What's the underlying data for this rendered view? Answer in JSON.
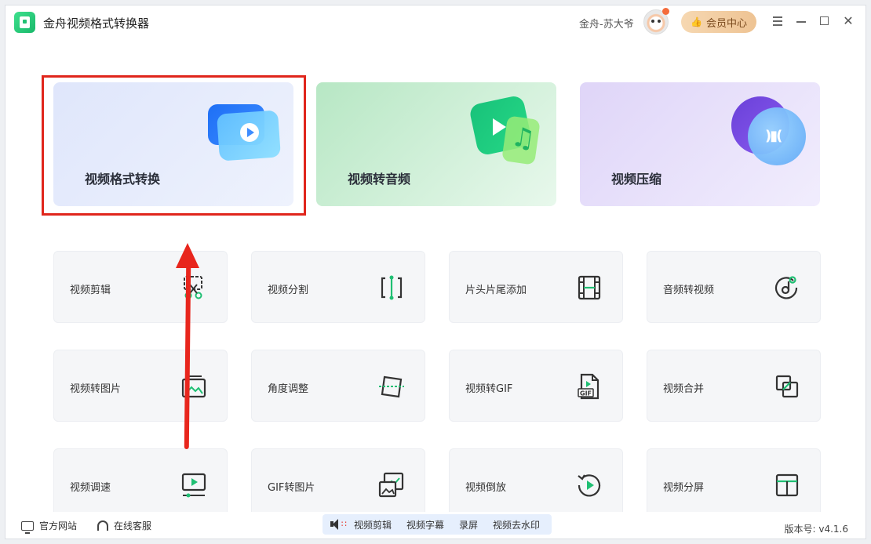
{
  "app": {
    "title": "金舟视频格式转换器",
    "username": "金舟-苏大爷",
    "vip_label": "会员中心"
  },
  "feature_cards": [
    {
      "label": "视频格式转换",
      "icon": "video-convert-icon",
      "accent": "#3d8cff"
    },
    {
      "label": "视频转音频",
      "icon": "music-note-icon",
      "accent": "#1fbf73"
    },
    {
      "label": "视频压缩",
      "icon": "compress-icon",
      "accent": "#7a4fe6"
    }
  ],
  "tools": [
    {
      "label": "视频剪辑",
      "icon": "scissors-icon"
    },
    {
      "label": "视频分割",
      "icon": "split-icon"
    },
    {
      "label": "片头片尾添加",
      "icon": "film-strip-icon"
    },
    {
      "label": "音频转视频",
      "icon": "audio-note-icon"
    },
    {
      "label": "视频转图片",
      "icon": "image-icon"
    },
    {
      "label": "角度调整",
      "icon": "rotate-frame-icon"
    },
    {
      "label": "视频转GIF",
      "icon": "gif-file-icon"
    },
    {
      "label": "视频合并",
      "icon": "merge-icon"
    },
    {
      "label": "视频调速",
      "icon": "speed-monitor-icon"
    },
    {
      "label": "GIF转图片",
      "icon": "gif-image-icon"
    },
    {
      "label": "视频倒放",
      "icon": "reverse-play-icon"
    },
    {
      "label": "视频分屏",
      "icon": "split-screen-icon"
    }
  ],
  "footer": {
    "site_label": "官方网站",
    "service_label": "在线客服",
    "promo_links": [
      "视频剪辑",
      "视频字幕",
      "录屏",
      "视频去水印"
    ],
    "version": "版本号: v4.1.6"
  },
  "colors": {
    "icon_dark": "#333333",
    "icon_green": "#1fbf73",
    "highlight": "#e0261c"
  }
}
